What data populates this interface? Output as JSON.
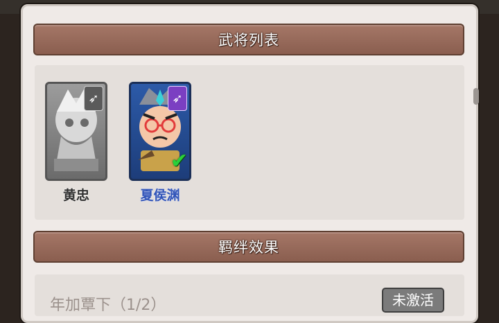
{
  "panel": {
    "hero_list_title": "武将列表",
    "bond_effect_title": "羁绊效果"
  },
  "heroes": [
    {
      "name": "黄忠",
      "owned": false,
      "class_icon": "bow-icon",
      "selected": false
    },
    {
      "name": "夏侯渊",
      "owned": true,
      "class_icon": "bow-icon",
      "selected": true
    }
  ],
  "bond": {
    "name": "年加覃下（1/2）",
    "button_label": "未激活"
  },
  "colors": {
    "header": "#a57767",
    "panel": "#efeae7",
    "check": "#2ad13a",
    "class_badge_active": "#7b3fc2"
  }
}
